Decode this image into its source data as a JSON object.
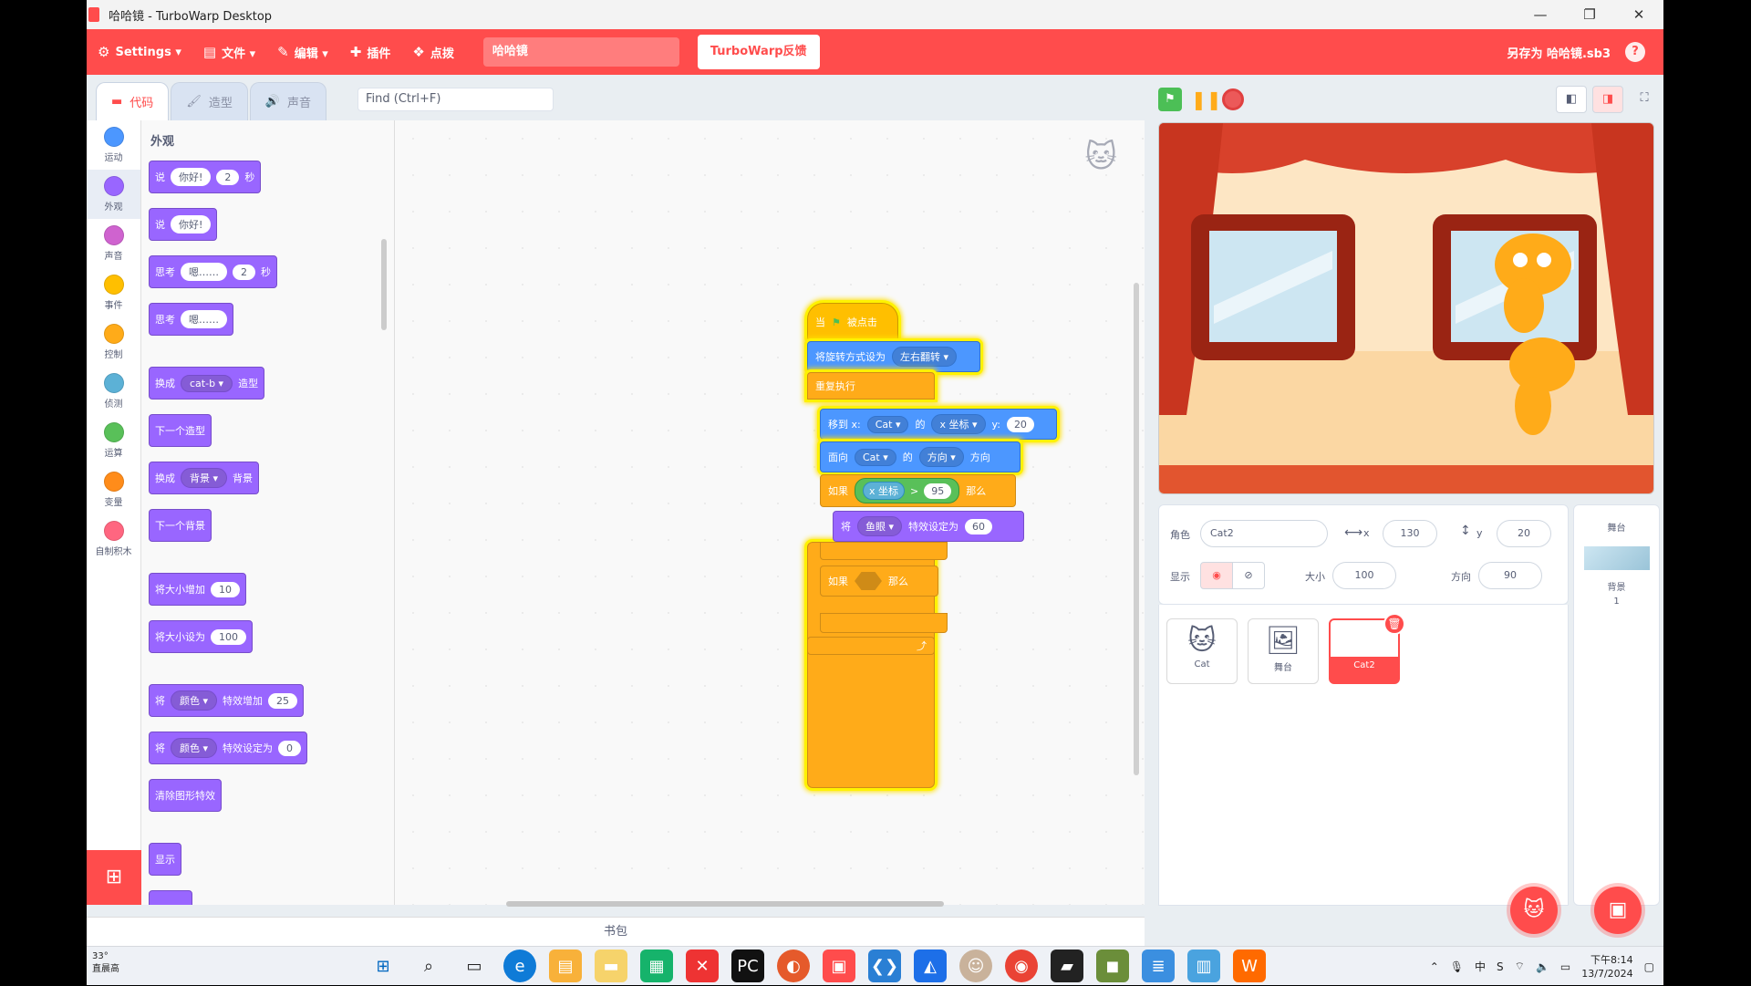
{
  "window": {
    "title": "哈哈镜 - TurboWarp Desktop",
    "min": "—",
    "max": "❐",
    "close": "✕"
  },
  "menu": {
    "settings": "Settings ▾",
    "file": "文件 ▾",
    "edit": "编辑 ▾",
    "plugins": "插件",
    "tutorials": "点拨",
    "project_title": "哈哈镜",
    "feedback": "TurboWarp反馈",
    "save_as": "另存为 哈哈镜.sb3",
    "help": "?"
  },
  "tabs": {
    "code": "代码",
    "costumes": "造型",
    "sounds": "声音"
  },
  "find": {
    "placeholder": "Find (Ctrl+F)"
  },
  "categories": [
    {
      "label": "运动",
      "color": "#4c97ff"
    },
    {
      "label": "外观",
      "color": "#9966ff"
    },
    {
      "label": "声音",
      "color": "#cf63cf"
    },
    {
      "label": "事件",
      "color": "#ffbf00"
    },
    {
      "label": "控制",
      "color": "#ffab19"
    },
    {
      "label": "侦测",
      "color": "#5cb1d6"
    },
    {
      "label": "运算",
      "color": "#59c059"
    },
    {
      "label": "变量",
      "color": "#ff8c1a"
    },
    {
      "label": "自制积木",
      "color": "#ff6680"
    }
  ],
  "palette": {
    "title": "外观",
    "b1": {
      "a": "说",
      "b": "你好!",
      "c": "2",
      "d": "秒"
    },
    "b2": {
      "a": "说",
      "b": "你好!"
    },
    "b3": {
      "a": "思考",
      "b": "嗯……",
      "c": "2",
      "d": "秒"
    },
    "b4": {
      "a": "思考",
      "b": "嗯……"
    },
    "b5": {
      "a": "换成",
      "b": "cat-b ▾",
      "c": "造型"
    },
    "b6": {
      "a": "下一个造型"
    },
    "b7": {
      "a": "换成",
      "b": "背景 ▾",
      "c": "背景"
    },
    "b8": {
      "a": "下一个背景"
    },
    "b9": {
      "a": "将大小增加",
      "b": "10"
    },
    "b10": {
      "a": "将大小设为",
      "b": "100"
    },
    "b11": {
      "a": "将",
      "b": "颜色 ▾",
      "c": "特效增加",
      "d": "25"
    },
    "b12": {
      "a": "将",
      "b": "颜色 ▾",
      "c": "特效设定为",
      "d": "0"
    },
    "b13": {
      "a": "清除图形特效"
    },
    "b14": {
      "a": "显示"
    }
  },
  "script": {
    "hat": {
      "a": "当",
      "b": "被点击"
    },
    "rotation": {
      "a": "将旋转方式设为",
      "b": "左右翻转 ▾"
    },
    "forever": "重复执行",
    "goto": {
      "a": "移到 x:",
      "b": "Cat ▾",
      "c": "的",
      "d": "x 坐标 ▾",
      "e": "y:",
      "f": "20"
    },
    "point": {
      "a": "面向",
      "b": "Cat ▾",
      "c": "的",
      "d": "方向 ▾",
      "e": "方向"
    },
    "if1": {
      "a": "如果",
      "b": "x 坐标",
      "c": ">",
      "d": "95",
      "e": "那么"
    },
    "effect": {
      "a": "将",
      "b": "鱼眼 ▾",
      "c": "特效设定为",
      "d": "60"
    },
    "if2": {
      "a": "如果",
      "b": "那么"
    },
    "loop_arrow": "⤴"
  },
  "zoom": {
    "in": "+",
    "out": "−",
    "reset": "="
  },
  "backpack": "书包",
  "sprite_info": {
    "sprite_label": "角色",
    "sprite_name": "Cat2",
    "x_label": "x",
    "x": "130",
    "y_label": "y",
    "y": "20",
    "show_label": "显示",
    "size_label": "大小",
    "size": "100",
    "dir_label": "方向",
    "direction": "90"
  },
  "sprites": [
    {
      "name": "Cat",
      "icon": "🐱"
    },
    {
      "name": "舞台",
      "icon": "🖼"
    },
    {
      "name": "Cat2",
      "icon": "🐱"
    }
  ],
  "stage_panel": {
    "title": "舞台",
    "backdrops_label": "背景",
    "backdrops_count": "1"
  },
  "taskbar": {
    "weather_temp": "33°",
    "weather_label": "直晨高",
    "time": "下午8:14",
    "date": "13/7/2024"
  },
  "colors": {
    "accent": "#ff4c4c",
    "looks": "#9966ff",
    "motion": "#4c97ff",
    "control": "#ffab19",
    "events": "#ffbf00"
  }
}
